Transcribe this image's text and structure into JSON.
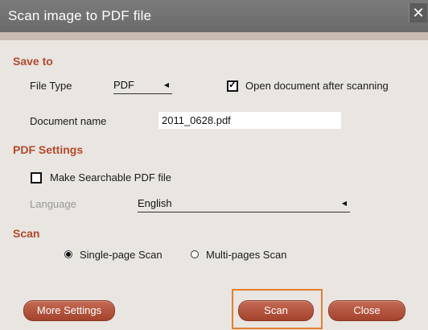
{
  "window": {
    "title": "Scan image to PDF file",
    "close_glyph": "✕"
  },
  "save_to": {
    "heading": "Save to",
    "file_type_label": "File Type",
    "file_type_value": "PDF",
    "open_after_label": "Open document after scanning",
    "open_after_checked": true,
    "document_name_label": "Document name",
    "document_name_value": "2011_0628.pdf"
  },
  "pdf_settings": {
    "heading": "PDF Settings",
    "searchable_label": "Make Searchable PDF file",
    "searchable_checked": false,
    "language_label": "Language",
    "language_value": "English"
  },
  "scan": {
    "heading": "Scan",
    "options": [
      {
        "label": "Single-page Scan",
        "selected": true
      },
      {
        "label": "Multi-pages Scan",
        "selected": false
      }
    ]
  },
  "buttons": {
    "more_settings": "More Settings",
    "scan": "Scan",
    "close": "Close"
  },
  "colors": {
    "accent": "#b4492c",
    "highlight": "#e57e2c",
    "titlebar": "#737373"
  }
}
